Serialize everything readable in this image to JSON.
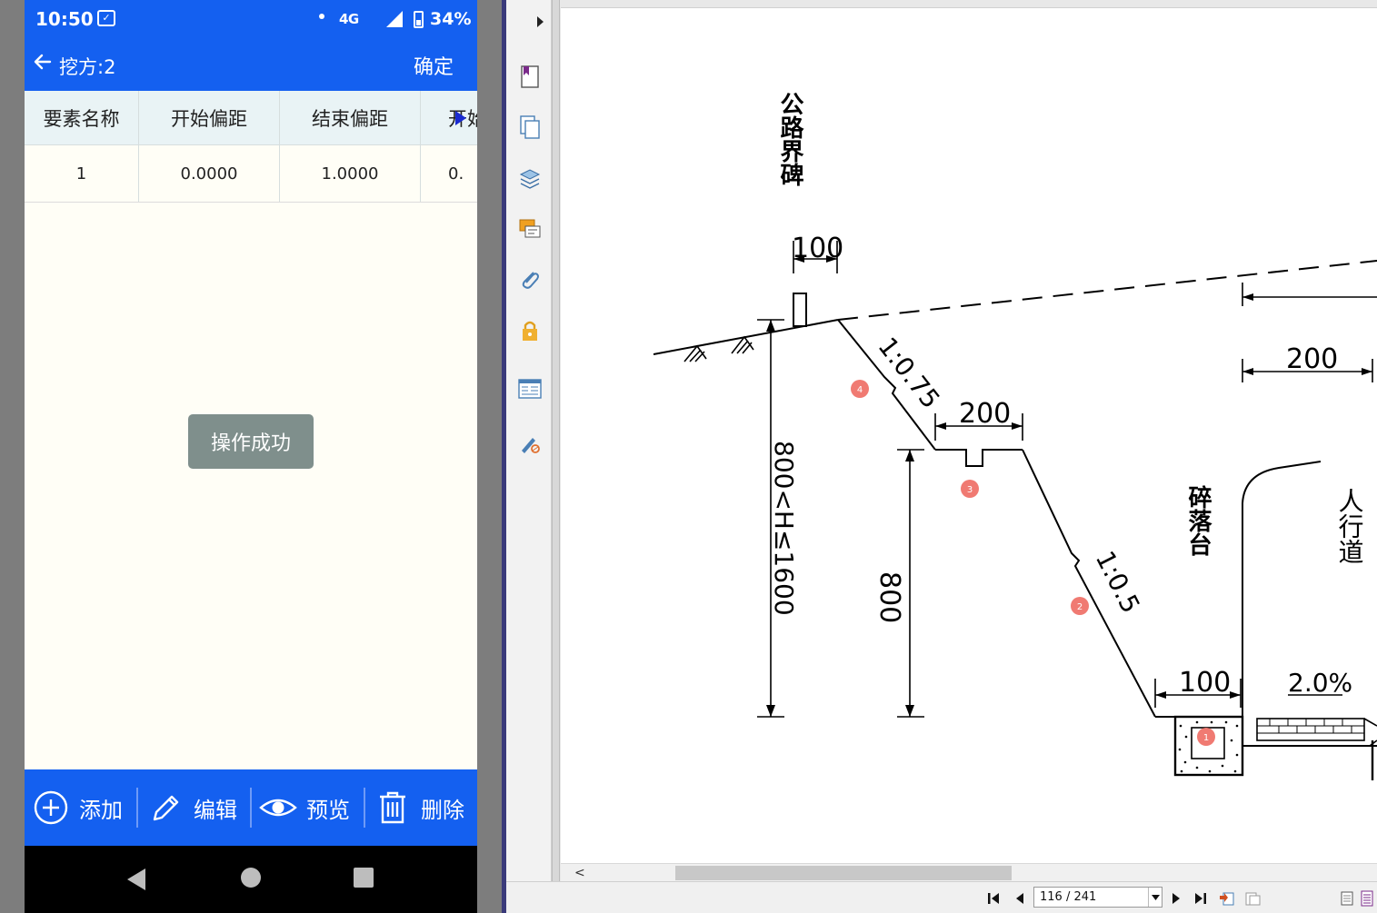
{
  "status_bar": {
    "time": "10:50",
    "network": "4G",
    "battery_percent": "34%"
  },
  "app_bar": {
    "title": "挖方:2",
    "confirm_label": "确定"
  },
  "table": {
    "headers": [
      "要素名称",
      "开始偏距",
      "结束偏距",
      "开始"
    ],
    "rows": [
      [
        "1",
        "0.0000",
        "1.0000",
        "0."
      ]
    ]
  },
  "toast": {
    "message": "操作成功"
  },
  "bottom_bar": {
    "add_label": "添加",
    "edit_label": "编辑",
    "preview_label": "预览",
    "delete_label": "删除"
  },
  "drawing": {
    "label_boundary_marker": "公路界碑",
    "label_rockfall_platform": "碎落台",
    "label_sidewalk": "人行道",
    "dim_100_top": "100",
    "dim_200_ditch": "200",
    "dim_200_right": "200",
    "dim_100_bottom": "100",
    "dim_800": "800",
    "dim_height_range": "800<H≤1600",
    "slope_upper": "1:0.75",
    "slope_lower": "1:0.5",
    "grade": "2.0%",
    "markers": [
      "1",
      "2",
      "3",
      "4"
    ]
  },
  "pdf_viewer": {
    "page_indicator": "116 / 241"
  },
  "colors": {
    "app_blue": "#1460f0",
    "header_bg": "#e9f3f5",
    "body_bg": "#fffef6",
    "toast_bg": "#7f8f8c",
    "marker_red": "#f07a72"
  }
}
